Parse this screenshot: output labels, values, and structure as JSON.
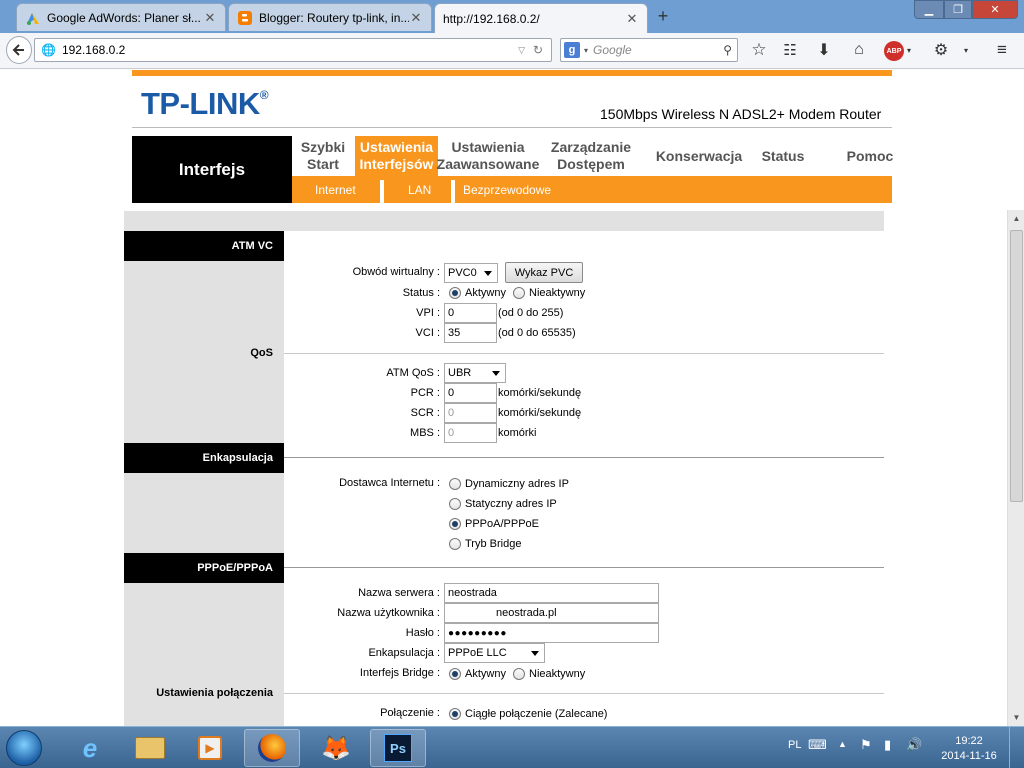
{
  "browser": {
    "tabs": [
      {
        "title": "Google AdWords: Planer sł...",
        "icon": "adwords-icon"
      },
      {
        "title": "Blogger: Routery tp-link, in...",
        "icon": "blogger-icon"
      },
      {
        "title": "http://192.168.0.2/",
        "icon": ""
      }
    ],
    "address": "192.168.0.2",
    "search_placeholder": "Google"
  },
  "router": {
    "brand": "TP-LINK",
    "model": "150Mbps Wireless N ADSL2+ Modem Router",
    "section_title": "Interfejs",
    "menu": [
      {
        "label": "Szybki\nStart",
        "active": false
      },
      {
        "label": "Ustawienia\nInterfejsów",
        "active": true
      },
      {
        "label": "Ustawienia\nZaawansowane",
        "active": false
      },
      {
        "label": "Zarządzanie\nDostępem",
        "active": false
      },
      {
        "label": "Konserwacja",
        "active": false
      },
      {
        "label": "Status",
        "active": false
      },
      {
        "label": "Pomoc",
        "active": false
      }
    ],
    "submenu": [
      "Internet",
      "LAN",
      "Bezprzewodowe"
    ]
  },
  "form": {
    "sections": {
      "atm_vc": "ATM VC",
      "qos": "QoS",
      "encapsulation": "Enkapsulacja",
      "pppoe": "PPPoE/PPPoA",
      "connection_settings": "Ustawienia połączenia"
    },
    "virtual_circuit": {
      "label": "Obwód wirtualny :",
      "value": "PVC0",
      "button": "Wykaz PVC"
    },
    "status": {
      "label": "Status :",
      "options": [
        "Aktywny",
        "Nieaktywny"
      ],
      "selected": "Aktywny"
    },
    "vpi": {
      "label": "VPI :",
      "value": "0",
      "hint": "(od 0 do 255)"
    },
    "vci": {
      "label": "VCI :",
      "value": "35",
      "hint": "(od 0 do 65535)"
    },
    "atm_qos": {
      "label": "ATM QoS :",
      "value": "UBR"
    },
    "pcr": {
      "label": "PCR :",
      "value": "0",
      "unit": "komórki/sekundę"
    },
    "scr": {
      "label": "SCR :",
      "value": "0",
      "unit": "komórki/sekundę"
    },
    "mbs": {
      "label": "MBS :",
      "value": "0",
      "unit": "komórki"
    },
    "isp": {
      "label": "Dostawca Internetu :",
      "options": [
        "Dynamiczny adres IP",
        "Statyczny adres IP",
        "PPPoA/PPPoE",
        "Tryb Bridge"
      ],
      "selected": "PPPoA/PPPoE"
    },
    "server_name": {
      "label": "Nazwa serwera :",
      "value": "neostrada"
    },
    "username": {
      "label": "Nazwa użytkownika :",
      "value": "neostrada.pl"
    },
    "password": {
      "label": "Hasło :",
      "value": "●●●●●●●●●"
    },
    "encapsulation_type": {
      "label": "Enkapsulacja :",
      "value": "PPPoE LLC"
    },
    "bridge_interface": {
      "label": "Interfejs Bridge :",
      "options": [
        "Aktywny",
        "Nieaktywny"
      ],
      "selected": "Aktywny"
    },
    "connection": {
      "label": "Połączenie :",
      "option": "Ciągłe połączenie (Zalecane)"
    }
  },
  "taskbar": {
    "apps": [
      "ie-icon",
      "explorer-icon",
      "media-player-icon",
      "firefox-icon",
      "fox-app-icon",
      "photoshop-icon"
    ],
    "language": "PL",
    "time": "19:22",
    "date": "2014-11-16"
  },
  "colors": {
    "accent_orange": "#f8961d",
    "brand_blue": "#1a5aa6"
  }
}
